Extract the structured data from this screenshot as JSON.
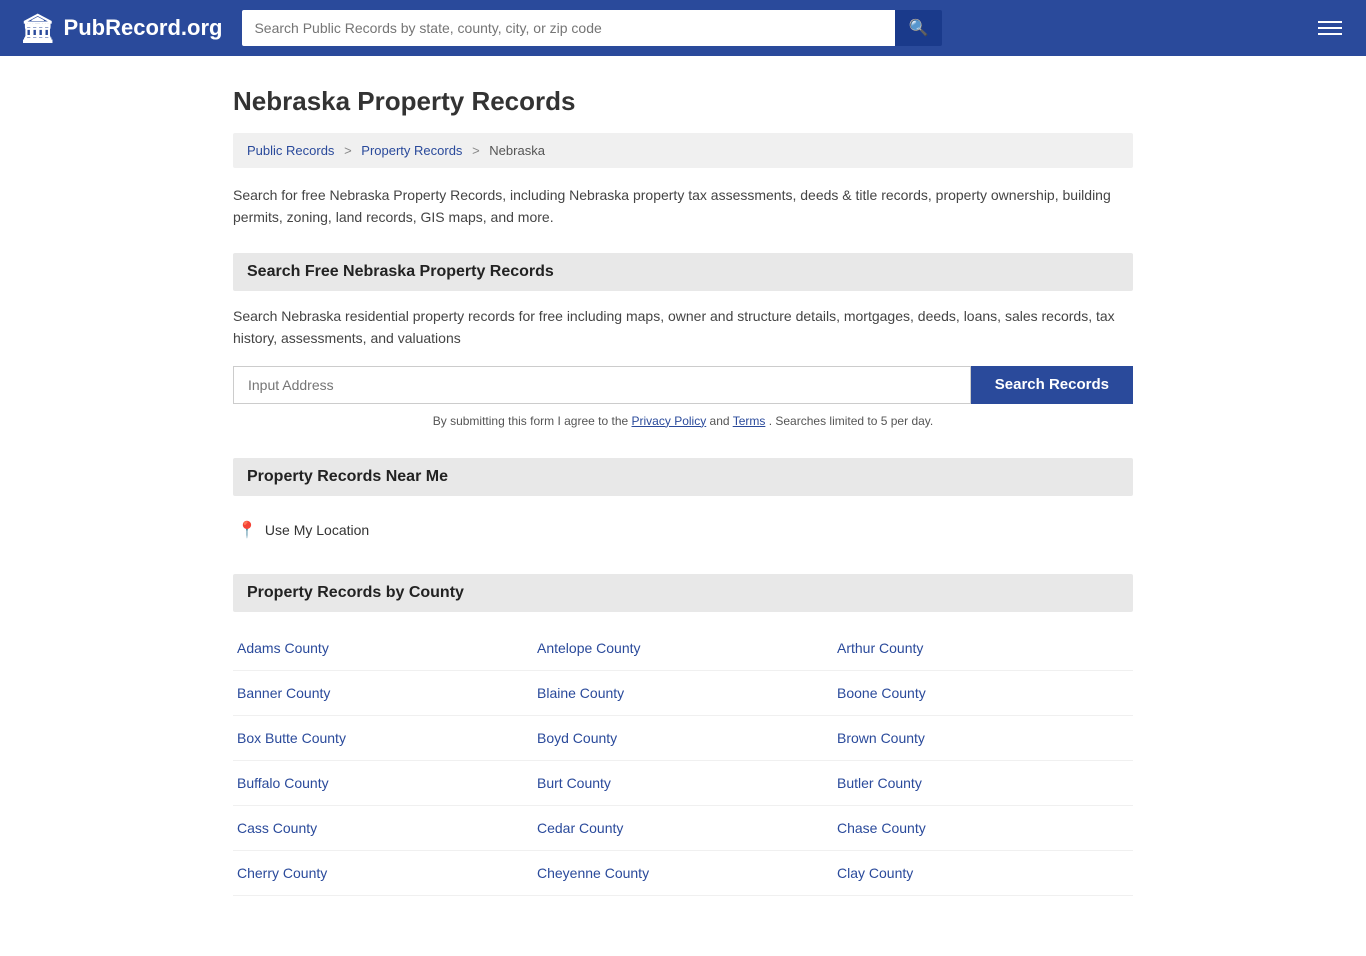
{
  "header": {
    "logo_text": "PubRecord.org",
    "search_placeholder": "Search Public Records by state, county, city, or zip code",
    "search_button_icon": "🔍",
    "menu_icon": "☰"
  },
  "page": {
    "title": "Nebraska Property Records",
    "breadcrumb": {
      "items": [
        "Public Records",
        "Property Records",
        "Nebraska"
      ],
      "separators": [
        ">",
        ">"
      ]
    },
    "description": "Search for free Nebraska Property Records, including Nebraska property tax assessments, deeds & title records, property ownership, building permits, zoning, land records, GIS maps, and more.",
    "search_section": {
      "heading": "Search Free Nebraska Property Records",
      "description": "Search Nebraska residential property records for free including maps, owner and structure details, mortgages, deeds, loans, sales records, tax history, assessments, and valuations",
      "input_placeholder": "Input Address",
      "button_label": "Search Records",
      "disclaimer": "By submitting this form I agree to the ",
      "privacy_policy_label": "Privacy Policy",
      "and_text": " and ",
      "terms_label": "Terms",
      "disclaimer_end": ". Searches limited to 5 per day."
    },
    "near_me_section": {
      "heading": "Property Records Near Me",
      "location_label": "Use My Location"
    },
    "county_section": {
      "heading": "Property Records by County",
      "counties": [
        "Adams County",
        "Antelope County",
        "Arthur County",
        "Banner County",
        "Blaine County",
        "Boone County",
        "Box Butte County",
        "Boyd County",
        "Brown County",
        "Buffalo County",
        "Burt County",
        "Butler County",
        "Cass County",
        "Cedar County",
        "Chase County",
        "Cherry County",
        "Cheyenne County",
        "Clay County"
      ]
    }
  }
}
